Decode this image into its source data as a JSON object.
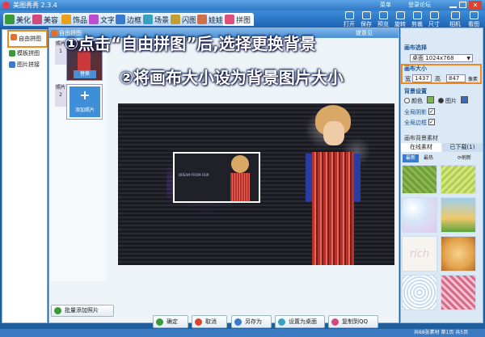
{
  "app": {
    "title": "美图秀秀 2.3.4",
    "top_links": [
      "菜单",
      "登录论坛"
    ]
  },
  "tabs": [
    {
      "label": "美化",
      "icon": "image-icon",
      "color": "#3a9a3a"
    },
    {
      "label": "美容",
      "icon": "face-icon",
      "color": "#d04a7a"
    },
    {
      "label": "饰品",
      "icon": "gift-icon",
      "color": "#e6a21c"
    },
    {
      "label": "文字",
      "icon": "text-icon",
      "color": "#c04ad0"
    },
    {
      "label": "边框",
      "icon": "frame-icon",
      "color": "#3a7ad0"
    },
    {
      "label": "场景",
      "icon": "scene-icon",
      "color": "#3aa0c0"
    },
    {
      "label": "闪图",
      "icon": "flash-icon",
      "color": "#c0a030"
    },
    {
      "label": "娃娃",
      "icon": "doll-icon",
      "color": "#d0704a"
    },
    {
      "label": "拼图",
      "icon": "puzzle-icon",
      "color": "#e0507a"
    }
  ],
  "toolbar": [
    "打开",
    "保存",
    "预览",
    "旋转",
    "剪裁",
    "尺寸",
    "相机",
    "看图"
  ],
  "sidebar": {
    "items": [
      {
        "label": "自由拼图",
        "color": "#e07030"
      },
      {
        "label": "模板拼图",
        "color": "#3a9a3a"
      },
      {
        "label": "图片拼接",
        "color": "#3a7ad0"
      }
    ]
  },
  "panel": {
    "title": "自由拼图",
    "help": "提意见"
  },
  "thumbs": {
    "items": [
      {
        "label": "照片1",
        "button": "替换"
      },
      {
        "label": "照片2",
        "button": "添加照片"
      }
    ],
    "batch_add": "批量添加照片"
  },
  "callouts": [
    "①点击“自由拼图”后,选择更换背景",
    "②将画布大小设为背景图片大小"
  ],
  "canvas_title": "DREAM FROM OUR",
  "bottom_buttons": [
    "确定",
    "取消",
    "另存为",
    "设置为桌面",
    "复制到QQ"
  ],
  "right": {
    "canvas_select_label": "画布选择",
    "canvas_select_value": "桌面 1024x768",
    "canvas_size_label": "画布大小",
    "width_label": "宽",
    "width": "1437",
    "height_label": "高",
    "height": "847",
    "px_label": "像素",
    "bg_label": "背景设置",
    "color_option": "颜色",
    "image_option": "图片",
    "shadow_label": "全局阴影",
    "border_label": "全局边框",
    "material_title": "画布背景素材",
    "material_tabs": [
      "在线素材",
      "已下载(1)"
    ],
    "material_filters": [
      "最新",
      "最热"
    ],
    "refresh": "刷新",
    "swatch_colors": [
      "#6f9f3a",
      "#b2cf55",
      "#d6e6f8",
      "#f0c86a",
      "#d0e7f5",
      "#e5bf8c",
      "#f0e8e0",
      "#e3a24b",
      "#c9dbf0",
      "#d86a8a"
    ]
  },
  "status": "共68张素材  第1页 共5页"
}
